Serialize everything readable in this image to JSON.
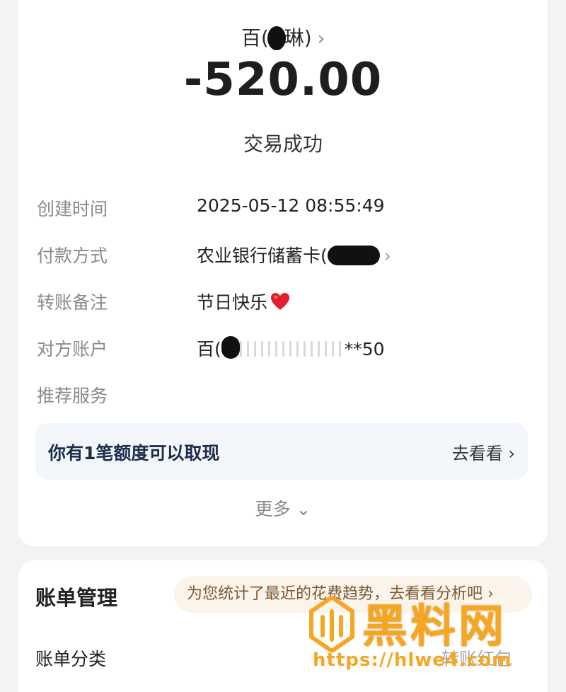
{
  "detail": {
    "payee_prefix": "百(",
    "payee_suffix": "琳)",
    "amount": "-520.00",
    "status": "交易成功",
    "rows": [
      {
        "label": "创建时间",
        "value": "2025-05-12 08:55:49"
      },
      {
        "label": "付款方式",
        "value": "农业银行储蓄卡("
      },
      {
        "label": "转账备注",
        "value": "节日快乐"
      },
      {
        "label": "对方账户",
        "value_prefix": "百(",
        "value_suffix": "**50"
      },
      {
        "label": "推荐服务"
      }
    ],
    "promo": {
      "text": "你有1笔额度可以取现",
      "link": "去看看"
    },
    "more": "更多"
  },
  "bill": {
    "title": "账单管理",
    "trend": "为您统计了最近的花费趋势，去看看分析吧",
    "category_label": "账单分类",
    "category_value": "转账红包"
  },
  "watermark": {
    "text": "黑料网",
    "url": "https://hlwe4.com"
  },
  "colors": {
    "accent_orange": "#f5a623",
    "heart": "#e0202a",
    "promo_bg": "#f3f6fb"
  }
}
